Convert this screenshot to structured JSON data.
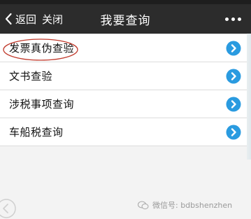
{
  "navbar": {
    "back_label": "返回",
    "close_label": "关闭",
    "title": "我要查询"
  },
  "list": {
    "items": [
      {
        "label": "发票真伪查验",
        "highlighted": true
      },
      {
        "label": "文书查验"
      },
      {
        "label": "涉税事项查询"
      },
      {
        "label": "车船税查询"
      }
    ]
  },
  "watermark": {
    "text": "微信号: bdbshenzhen"
  },
  "colors": {
    "navbar_bg": "#2c2c2c",
    "chevron_blue": "#2a9be0",
    "highlight_red": "#c0392b"
  }
}
